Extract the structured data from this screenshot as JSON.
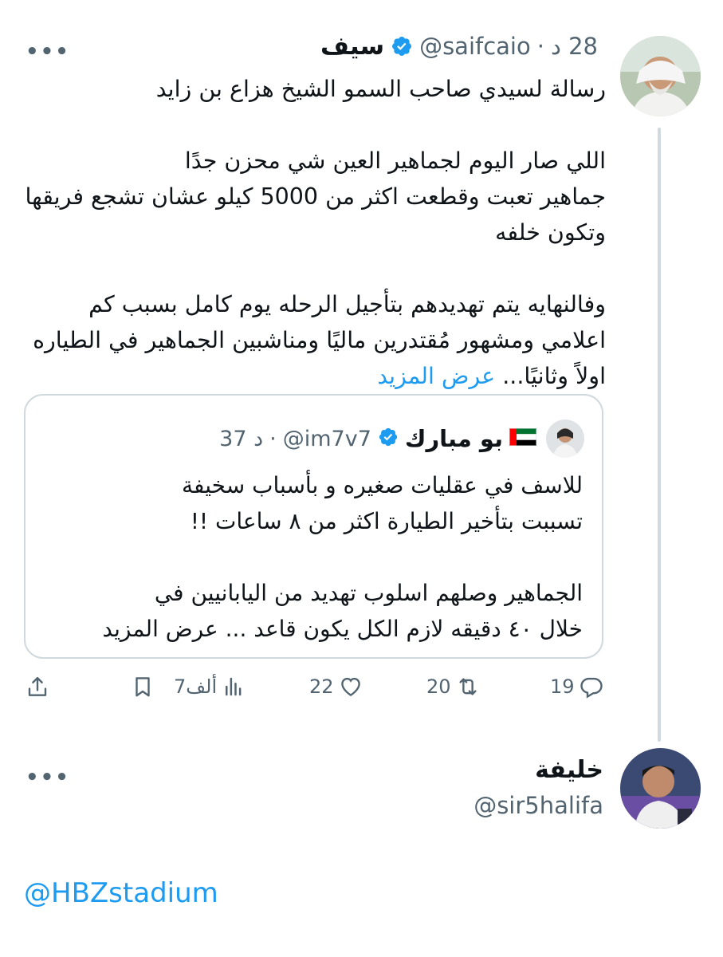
{
  "tweet": {
    "author_name": "سيف",
    "handle": "@saifcaio",
    "time": "28 د",
    "paragraphs": [
      "رسالة لسيدي صاحب السمو الشيخ هزاع بن زايد",
      "اللي صار اليوم لجماهير العين شي محزن جدًا\nجماهير تعبت وقطعت اكثر من 5000 كيلو  عشان تشجع فريقها وتكون خلفه",
      "وفالنهايه يتم تهديدهم بتأجيل الرحله يوم كامل بسبب كم اعلامي ومشهور مُقتدرين ماليًا ومناشبين الجماهير في الطياره اولاً وثانيًا..."
    ],
    "show_more": "عرض المزيد"
  },
  "quote": {
    "author_name": "بو مبارك",
    "flag": "🇦🇪",
    "handle": "@im7v7",
    "time": "37 د",
    "paragraphs": [
      "للاسف في عقليات صغيره و بأسباب سخيفة\nتسببت بتأخير الطيارة اكثر من ٨ ساعات !!",
      "الجماهير وصلهم اسلوب تهديد من اليابانيين في\nخلال ٤٠ دقيقه لازم الكل يكون قاعد ... عرض المزيد"
    ]
  },
  "actions": {
    "replies": "19",
    "retweets": "20",
    "likes": "22",
    "views": "7ألف"
  },
  "reply": {
    "author_name": "خليفة",
    "handle": "@sir5halifa"
  },
  "mention": "@HBZstadium",
  "more_label": "•••",
  "colors": {
    "accent": "#1d9bf0",
    "muted": "#536471",
    "border": "#cfd9de"
  }
}
